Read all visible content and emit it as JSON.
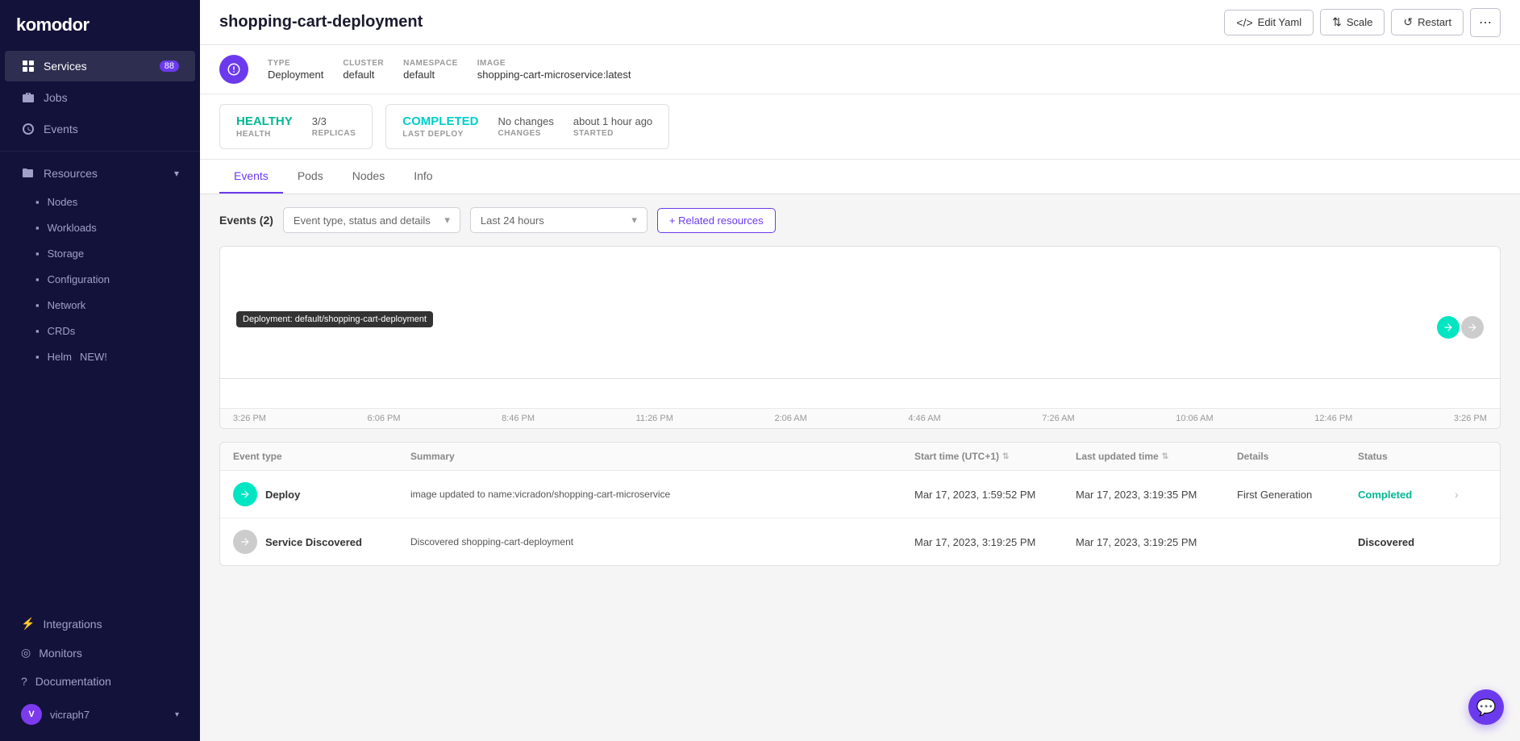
{
  "sidebar": {
    "logo": "komodor",
    "items": [
      {
        "id": "services",
        "label": "Services",
        "badge": "88",
        "active": true,
        "icon": "grid"
      },
      {
        "id": "jobs",
        "label": "Jobs",
        "icon": "briefcase"
      },
      {
        "id": "events",
        "label": "Events",
        "icon": "clock"
      }
    ],
    "resources": {
      "label": "Resources",
      "children": [
        {
          "id": "nodes",
          "label": "Nodes"
        },
        {
          "id": "workloads",
          "label": "Workloads"
        },
        {
          "id": "storage",
          "label": "Storage"
        },
        {
          "id": "configuration",
          "label": "Configuration"
        },
        {
          "id": "network",
          "label": "Network"
        },
        {
          "id": "crds",
          "label": "CRDs"
        },
        {
          "id": "helm",
          "label": "Helm",
          "badge_new": "NEW!"
        }
      ]
    },
    "bottom_items": [
      {
        "id": "integrations",
        "label": "Integrations"
      },
      {
        "id": "monitors",
        "label": "Monitors"
      },
      {
        "id": "documentation",
        "label": "Documentation"
      }
    ],
    "user": {
      "name": "vicraph7",
      "avatar": "V"
    }
  },
  "topbar": {
    "title": "shopping-cart-deployment",
    "buttons": {
      "edit_yaml": "Edit Yaml",
      "scale": "Scale",
      "restart": "Restart",
      "more": "..."
    }
  },
  "meta": {
    "type_label": "TYPE",
    "type_value": "Deployment",
    "cluster_label": "CLUSTER",
    "cluster_value": "default",
    "namespace_label": "NAMESPACE",
    "namespace_value": "default",
    "image_label": "IMAGE",
    "image_value": "shopping-cart-microservice:latest"
  },
  "status_cards": [
    {
      "primary_label": "HEALTH",
      "primary_value": "HEALTHY",
      "primary_color": "green",
      "secondary_label": "REPLICAS",
      "secondary_value": "3/3"
    },
    {
      "primary_label": "LAST DEPLOY",
      "primary_value": "COMPLETED",
      "primary_color": "teal",
      "secondary_label": "CHANGES",
      "secondary_value": "No changes",
      "tertiary_label": "STARTED",
      "tertiary_value": "about 1 hour ago"
    }
  ],
  "tabs": [
    {
      "id": "events",
      "label": "Events",
      "active": true
    },
    {
      "id": "pods",
      "label": "Pods"
    },
    {
      "id": "nodes",
      "label": "Nodes"
    },
    {
      "id": "info",
      "label": "Info"
    }
  ],
  "events_toolbar": {
    "count_label": "Events (2)",
    "filter_placeholder": "Event type, status and details",
    "time_filter": "Last 24 hours",
    "related_btn": "+ Related resources"
  },
  "timeline": {
    "deployment_label": "Deployment: default/shopping-cart-deployment",
    "times": [
      "3:26 PM",
      "6:06 PM",
      "8:46 PM",
      "11:26 PM",
      "2:06 AM",
      "4:46 AM",
      "7:26 AM",
      "10:06 AM",
      "12:46 PM",
      "3:26 PM"
    ]
  },
  "table": {
    "headers": [
      {
        "label": "Event type"
      },
      {
        "label": "Summary"
      },
      {
        "label": "Start time (UTC+1)",
        "sortable": true
      },
      {
        "label": "Last updated time",
        "sortable": true
      },
      {
        "label": "Details"
      },
      {
        "label": "Status"
      },
      {
        "label": ""
      }
    ],
    "rows": [
      {
        "event_type": "Deploy",
        "dot_color": "green",
        "summary": "image updated to name:vicradon/shopping-cart-microservice",
        "start_time": "Mar 17, 2023, 1:59:52 PM",
        "last_updated": "Mar 17, 2023, 3:19:35 PM",
        "details": "First Generation",
        "status": "Completed",
        "status_color": "completed"
      },
      {
        "event_type": "Service Discovered",
        "dot_color": "gray",
        "summary": "Discovered shopping-cart-deployment",
        "start_time": "Mar 17, 2023, 3:19:25 PM",
        "last_updated": "Mar 17, 2023, 3:19:25 PM",
        "details": "",
        "status": "Discovered",
        "status_color": "discovered"
      }
    ]
  }
}
